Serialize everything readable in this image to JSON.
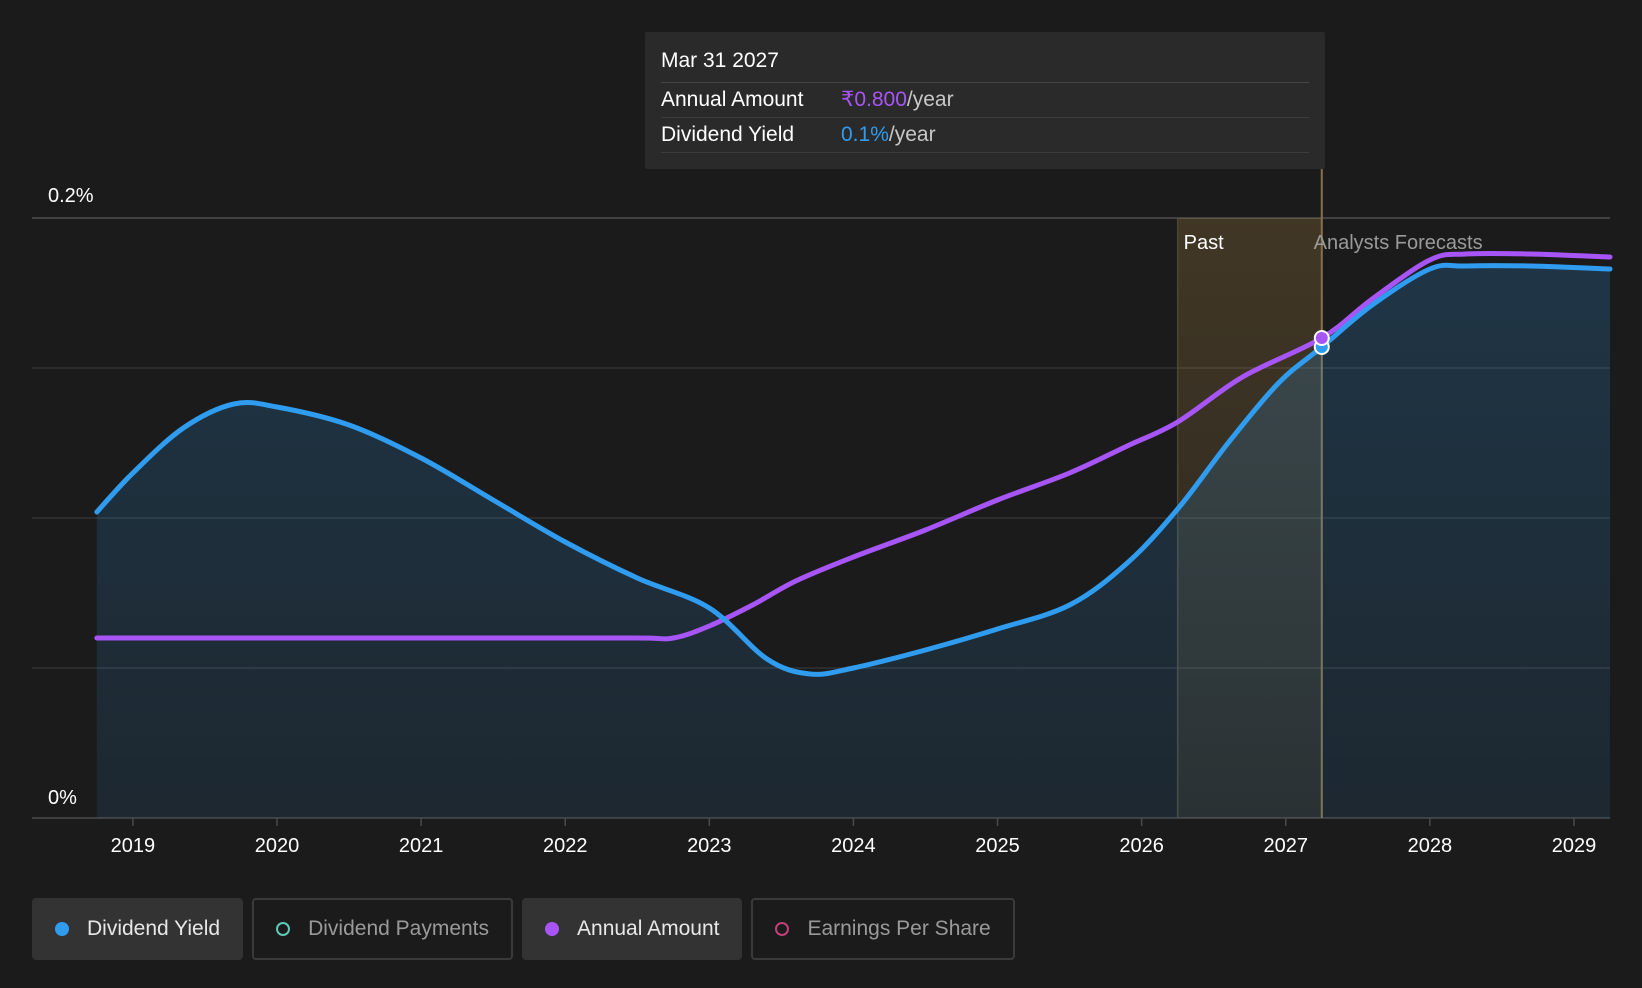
{
  "tooltip": {
    "date": "Mar 31 2027",
    "rows": [
      {
        "label": "Annual Amount",
        "value": "₹0.800",
        "unit": "/year"
      },
      {
        "label": "Dividend Yield",
        "value": "0.1%",
        "unit": "/year"
      }
    ]
  },
  "legend": [
    {
      "label": "Dividend Yield",
      "color": "#2f9cf0",
      "active": true,
      "filled": true
    },
    {
      "label": "Dividend Payments",
      "color": "#5ec9b8",
      "active": false,
      "filled": false
    },
    {
      "label": "Annual Amount",
      "color": "#a855f7",
      "active": true,
      "filled": true
    },
    {
      "label": "Earnings Per Share",
      "color": "#c0407a",
      "active": false,
      "filled": false
    }
  ],
  "colors": {
    "background": "#1b1b1b",
    "dividend_yield": "#2f9cf0",
    "annual_amount": "#a855f7",
    "past_band": "#c99a4a",
    "grid": "#3a3a3a"
  },
  "chart_data": {
    "type": "line",
    "y_tick_labels": [
      "0%",
      "0.2%"
    ],
    "ylim": [
      0,
      0.2
    ],
    "y_unit": "%",
    "xlim": [
      2018.3,
      2029.25
    ],
    "x_tick_labels": [
      "2019",
      "2020",
      "2021",
      "2022",
      "2023",
      "2024",
      "2025",
      "2026",
      "2027",
      "2028",
      "2029"
    ],
    "grid": true,
    "past_label": "Past",
    "forecast_label": "Analysts Forecasts",
    "past_band": [
      2026.25,
      2027.25
    ],
    "highlight_x": 2027.25,
    "series": [
      {
        "name": "Dividend Yield",
        "color": "#2f9cf0",
        "fill": true,
        "points": [
          [
            2018.75,
            0.102
          ],
          [
            2019.0,
            0.115
          ],
          [
            2019.35,
            0.13
          ],
          [
            2019.7,
            0.138
          ],
          [
            2020.0,
            0.137
          ],
          [
            2020.5,
            0.131
          ],
          [
            2021.0,
            0.12
          ],
          [
            2021.5,
            0.106
          ],
          [
            2022.0,
            0.092
          ],
          [
            2022.5,
            0.08
          ],
          [
            2023.0,
            0.07
          ],
          [
            2023.4,
            0.053
          ],
          [
            2023.7,
            0.048
          ],
          [
            2024.0,
            0.05
          ],
          [
            2024.5,
            0.056
          ],
          [
            2025.0,
            0.063
          ],
          [
            2025.5,
            0.071
          ],
          [
            2025.9,
            0.085
          ],
          [
            2026.25,
            0.103
          ],
          [
            2026.6,
            0.125
          ],
          [
            2026.95,
            0.145
          ],
          [
            2027.25,
            0.157
          ],
          [
            2027.6,
            0.171
          ],
          [
            2028.0,
            0.183
          ],
          [
            2028.25,
            0.184
          ],
          [
            2028.7,
            0.184
          ],
          [
            2029.25,
            0.183
          ]
        ]
      },
      {
        "name": "Annual Amount",
        "color": "#a855f7",
        "fill": false,
        "points": [
          [
            2018.75,
            0.06
          ],
          [
            2019.5,
            0.06
          ],
          [
            2020.5,
            0.06
          ],
          [
            2021.5,
            0.06
          ],
          [
            2022.5,
            0.06
          ],
          [
            2022.75,
            0.06
          ],
          [
            2023.0,
            0.064
          ],
          [
            2023.3,
            0.071
          ],
          [
            2023.6,
            0.079
          ],
          [
            2024.0,
            0.087
          ],
          [
            2024.5,
            0.096
          ],
          [
            2025.0,
            0.106
          ],
          [
            2025.5,
            0.115
          ],
          [
            2025.9,
            0.124
          ],
          [
            2026.25,
            0.132
          ],
          [
            2026.7,
            0.147
          ],
          [
            2027.25,
            0.16
          ],
          [
            2027.6,
            0.173
          ],
          [
            2028.0,
            0.186
          ],
          [
            2028.25,
            0.188
          ],
          [
            2028.7,
            0.188
          ],
          [
            2029.25,
            0.187
          ]
        ]
      }
    ]
  }
}
